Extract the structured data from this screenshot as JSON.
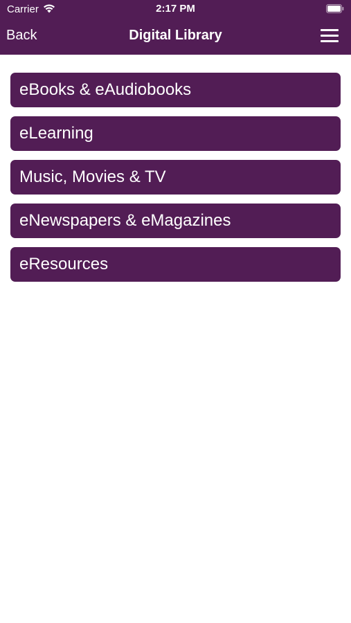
{
  "colors": {
    "brand": "#521D55",
    "text_on_brand": "#FFFFFF",
    "background": "#FFFFFF"
  },
  "status_bar": {
    "carrier": "Carrier",
    "time": "2:17 PM",
    "icons": [
      "wifi-icon",
      "battery-icon"
    ]
  },
  "nav_bar": {
    "back_label": "Back",
    "title": "Digital Library",
    "menu_icon": "hamburger-menu-icon"
  },
  "menu_items": [
    {
      "label": "eBooks & eAudiobooks"
    },
    {
      "label": "eLearning"
    },
    {
      "label": "Music, Movies & TV"
    },
    {
      "label": "eNewspapers & eMagazines"
    },
    {
      "label": "eResources"
    }
  ]
}
